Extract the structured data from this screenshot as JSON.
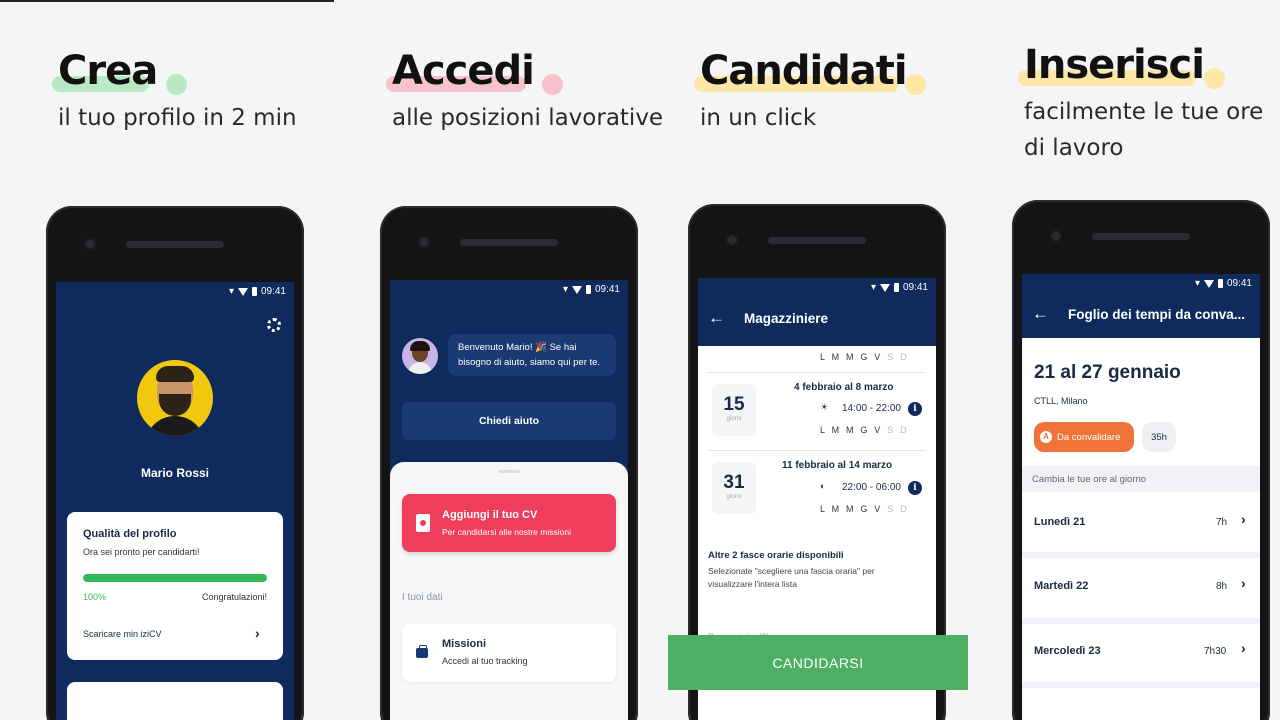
{
  "colors": {
    "navy": "#0f2a5c",
    "green_highlight": "#b9e8c4",
    "pink_highlight": "#f7c1cd",
    "yellow_highlight": "#fde6a6",
    "cv_red": "#ef3e5c",
    "cta_green": "#4caf62",
    "pending_orange": "#f0743a"
  },
  "panels": [
    {
      "headline": "Crea",
      "sub": "il tuo profilo in 2 min"
    },
    {
      "headline": "Accedi",
      "sub": "alle posizioni lavorative"
    },
    {
      "headline": "Candidati",
      "sub": "in un click"
    },
    {
      "headline": "Inserisci",
      "sub1": "facilmente le tue ore",
      "sub2": "di lavoro"
    }
  ],
  "status_time": "09:41",
  "screen1": {
    "icon": "gear-icon",
    "user_name": "Mario Rossi",
    "card_title": "Qualità del profilo",
    "card_sub": "Ora sei pronto per candidarti!",
    "progress": 1.0,
    "progress_label": "100%",
    "progress_msg": "Congratulazioni!",
    "link": "Scaricare min iziCV"
  },
  "screen2": {
    "bubble_line1": "Benvenuto Mario! 🎉 Se hai",
    "bubble_line2": "bisogno di aiuto, siamo qui per te.",
    "help_button": "Chiedi aiuto",
    "cv_title": "Aggiungi il tuo CV",
    "cv_sub": "Per candidarsi alle nostre missioni",
    "section": "I tuoi dati",
    "missions_title": "Missioni",
    "missions_sub": "Accedi al tuo tracking"
  },
  "screen3": {
    "title": "Magazziniere",
    "days_active": "L M M G V",
    "days_off": "S D",
    "slots": [
      {
        "num": "15",
        "unit": "giorni",
        "range": "4 febbraio al 8 marzo",
        "hours": "14:00 - 22:00"
      },
      {
        "num": "31",
        "unit": "giorni",
        "range": "11 febbraio al 14 marzo",
        "hours": "22:00 - 06:00"
      }
    ],
    "more_title": "Altre 2 fasce orarie disponibili",
    "more_line1": "Selezionate \"scegliere una fascia oraria\" per",
    "more_line2": "visualizzare l'intera lista",
    "requisites": "Prerequisito (2)",
    "cta": "CANDIDARSI"
  },
  "screen4": {
    "title": "Foglio dei tempi da conva...",
    "week": "21 al 27 gennaio",
    "place": "CTLL, Milano",
    "status": "Da convalidare",
    "total": "35h",
    "band": "Cambia le tue ore al giorno",
    "days": [
      {
        "label": "Lunedì  21",
        "hours": "7h"
      },
      {
        "label": "Martedì 22",
        "hours": "8h"
      },
      {
        "label": "Mercoledì 23",
        "hours": "7h30"
      }
    ]
  }
}
